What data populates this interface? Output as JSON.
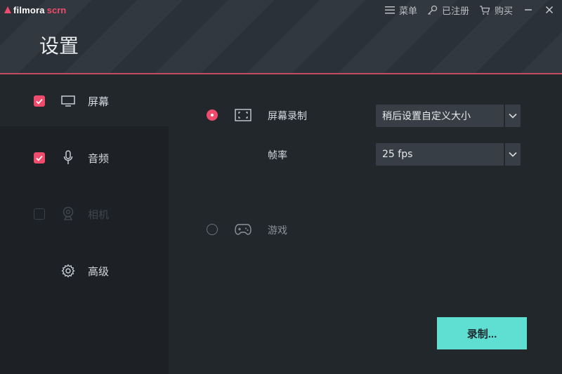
{
  "app": {
    "logo_main": "filmora",
    "logo_sub": "scrn",
    "page_title": "设置"
  },
  "top_menu": {
    "menu_label": "菜单",
    "register_label": "已注册",
    "buy_label": "购买",
    "minimize_label": "—",
    "close_label": "✕"
  },
  "sidebar": {
    "items": [
      {
        "label": "屏幕",
        "icon": "monitor-icon",
        "checked": true,
        "enabled": true
      },
      {
        "label": "音频",
        "icon": "microphone-icon",
        "checked": true,
        "enabled": true
      },
      {
        "label": "相机",
        "icon": "webcam-icon",
        "checked": false,
        "enabled": false
      },
      {
        "label": "高级",
        "icon": "gear-icon",
        "checked": null,
        "enabled": true
      }
    ]
  },
  "main": {
    "screen_record": {
      "label": "屏幕录制",
      "selected": true,
      "icon": "capture-frame-icon"
    },
    "size_select": {
      "value": "稍后设置自定义大小"
    },
    "fps": {
      "label": "帧率",
      "value": "25 fps"
    },
    "game": {
      "label": "游戏",
      "selected": false,
      "icon": "gamepad-icon"
    },
    "record_button": "录制..."
  },
  "colors": {
    "accent": "#ef4b6c",
    "record_button": "#5edfd1",
    "background": "#22272c",
    "sidebar": "#1d2125"
  }
}
